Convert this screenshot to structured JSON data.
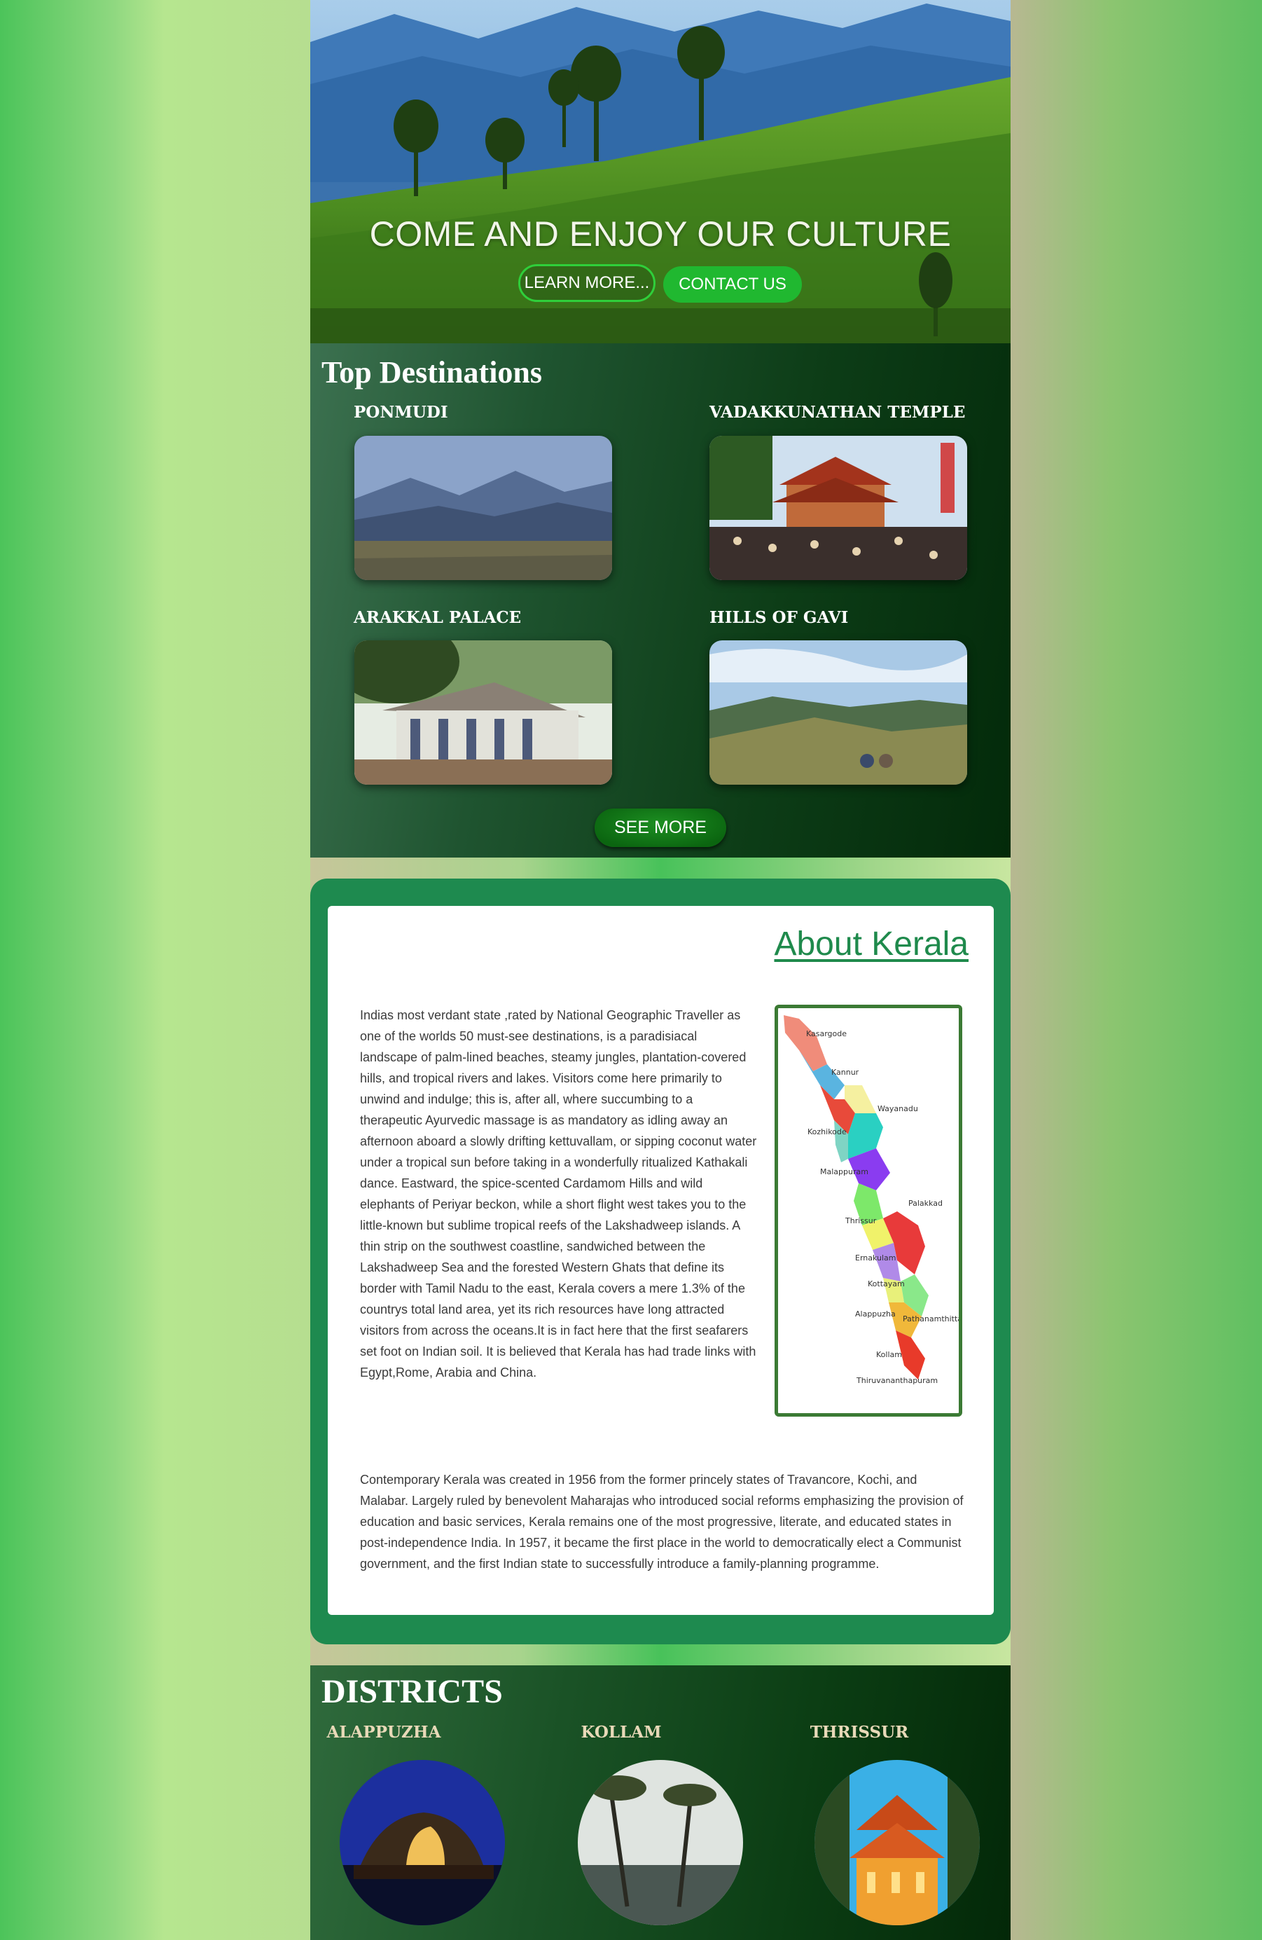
{
  "hero": {
    "title": "COME AND ENJOY OUR CULTURE",
    "learn_more": "LEARN MORE...",
    "contact_us": "CONTACT US"
  },
  "destinations": {
    "title": "Top Destinations",
    "items": [
      {
        "label": "PONMUDI"
      },
      {
        "label": "VADAKKUNATHAN TEMPLE"
      },
      {
        "label": "ARAKKAL PALACE"
      },
      {
        "label": "HILLS OF GAVI"
      }
    ],
    "see_more": "SEE MORE"
  },
  "about": {
    "title": "About Kerala",
    "p1": "Indias most verdant state ,rated by National Geographic Traveller as one of the worlds 50 must-see destinations, is a paradisiacal landscape of palm-lined beaches, steamy jungles, plantation-covered hills, and tropical rivers and lakes. Visitors come here primarily to unwind and indulge; this is, after all, where succumbing to a therapeutic Ayurvedic massage is as mandatory as idling away an afternoon aboard a slowly drifting kettuvallam, or sipping coconut water under a tropical sun before taking in a wonderfully ritualized Kathakali dance. Eastward, the spice-scented Cardamom Hills and wild elephants of Periyar beckon, while a short flight west takes you to the little-known but sublime tropical reefs of the Lakshadweep islands. A thin strip on the southwest coastline, sandwiched between the Lakshadweep Sea and the forested Western Ghats that define its border with Tamil Nadu to the east, Kerala covers a mere 1.3% of the countrys total land area, yet its rich resources have long attracted visitors from across the oceans.It is in fact here that the first seafarers set foot on Indian soil. It is believed that Kerala has had trade links with Egypt,Rome, Arabia and China.",
    "p2": "Contemporary Kerala was created in 1956 from the former princely states of Travancore, Kochi, and Malabar. Largely ruled by benevolent Maharajas who introduced social reforms emphasizing the provision of education and basic services, Kerala remains one of the most progressive, literate, and educated states in post-independence India. In 1957, it became the first place in the world to democratically elect a Communist government, and the first Indian state to successfully introduce a family-planning programme.",
    "map_labels": [
      "Kasargode",
      "Kannur",
      "Wayanadu",
      "Kozhikode",
      "Malappuram",
      "Palakkad",
      "Thrissur",
      "Ernakulam",
      "Kottayam",
      "Alappuzha",
      "Pathanamthitta",
      "Kollam",
      "Thiruvananthapuram"
    ]
  },
  "districts": {
    "title": "DISTRICTS",
    "items": [
      {
        "label": "ALAPPUZHA"
      },
      {
        "label": "KOLLAM"
      },
      {
        "label": "THRISSUR"
      }
    ]
  }
}
